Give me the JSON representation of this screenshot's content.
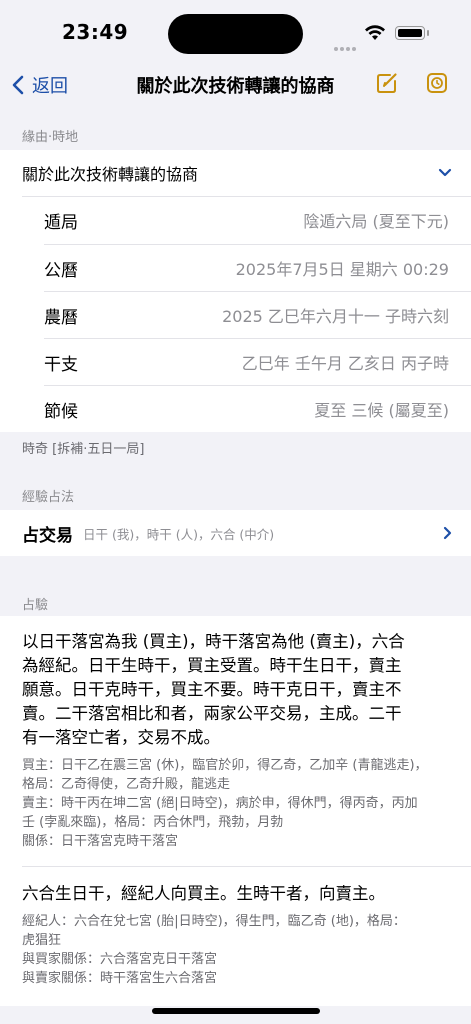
{
  "status": {
    "time": "23:49"
  },
  "nav": {
    "back_label": "返回",
    "title": "關於此次技術轉讓的協商"
  },
  "section1": {
    "header": "緣由·時地",
    "topic": "關於此次技術轉讓的協商",
    "details": [
      {
        "label": "遁局",
        "value": "陰遁六局 (夏至下元)"
      },
      {
        "label": "公曆",
        "value": "2025年7月5日 星期六 00:29"
      },
      {
        "label": "農曆",
        "value": "2025 乙巳年六月十一 子時六刻"
      },
      {
        "label": "干支",
        "value": "乙巳年 壬午月 乙亥日 丙子時"
      },
      {
        "label": "節候",
        "value": "夏至 三候 (屬夏至)"
      }
    ],
    "footer": "時奇 [拆補·五日一局]"
  },
  "section2": {
    "header": "經驗占法",
    "method_title": "占交易",
    "method_desc": "日干 (我)，時干 (人)，六合 (中介)"
  },
  "section3": {
    "header": "占驗",
    "block1": {
      "main_lines": [
        "以日干落宮為我 (買主)，時干落宮為他 (賣主)，六合",
        "為經紀。日干生時干，買主受置。時干生日干，賣主",
        "願意。日干克時干，買主不要。時干克日干，賣主不",
        "賣。二干落宮相比和者，兩家公平交易，主成。二干",
        "有一落空亡者，交易不成。"
      ],
      "detail_lines": [
        "買主：日干乙在震三宮 (休)，臨官於卯，得乙奇，乙加辛 (青龍逃走)，",
        "格局：乙奇得使，乙奇升殿，龍逃走",
        "賣主：時干丙在坤二宮 (絕|日時空)，病於申，得休門，得丙奇，丙加",
        "壬 (孛亂來臨)，格局：丙合休門，飛勃，月勃",
        "關係：日干落宮克時干落宮"
      ]
    },
    "block2": {
      "main": "六合生日干，經紀人向買主。生時干者，向賣主。",
      "detail_lines": [
        "經紀人：六合在兌七宮 (胎|日時空)，得生門，臨乙奇 (地)，格局：",
        "虎猖狂",
        "與買家關係：六合落宮克日干落宮",
        "與賣家關係：時干落宮生六合落宮"
      ]
    }
  },
  "colors": {
    "accent": "#1d4fa8",
    "icon_gold": "#c9920e",
    "background": "#f2f2f7"
  }
}
